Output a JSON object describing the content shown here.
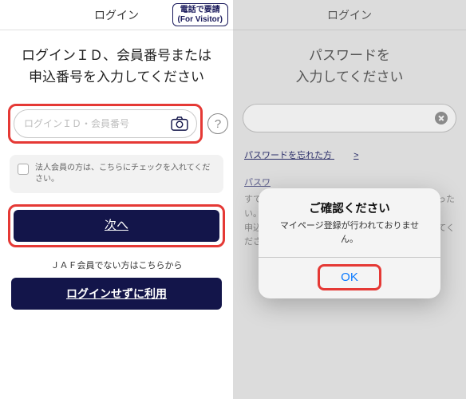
{
  "left": {
    "header_title": "ログイン",
    "visitor_btn_l1": "電話で要請",
    "visitor_btn_l2": "(For Visitor)",
    "instruction_l1": "ログインＩＤ、会員番号または",
    "instruction_l2": "申込番号を入力してください",
    "id_placeholder": "ログインＩＤ・会員番号",
    "help_label": "?",
    "corp_checkbox_label": "法人会員の方は、こちらにチェックを入れてください。",
    "next_button": "次へ",
    "nonmember_note": "ＪＡＦ会員でない方はこちらから",
    "guest_button": "ログインせずに利用"
  },
  "right": {
    "header_title": "ログイン",
    "instruction_l1": "パスワードを",
    "instruction_l2": "入力してください",
    "forgot_link": "パスワードを忘れた方",
    "forgot_gt": ">",
    "bg_link2": "パスワ",
    "bg_para_l1": "すでに",
    "bg_para_l2": "い。",
    "bg_para_l3": "申込番",
    "bg_para_l4": "ださい",
    "bg_para_r1": "った",
    "bg_para_r2": "てく",
    "alert": {
      "title": "ご確認ください",
      "message": "マイページ登録が行われておりません。",
      "ok": "OK"
    }
  }
}
